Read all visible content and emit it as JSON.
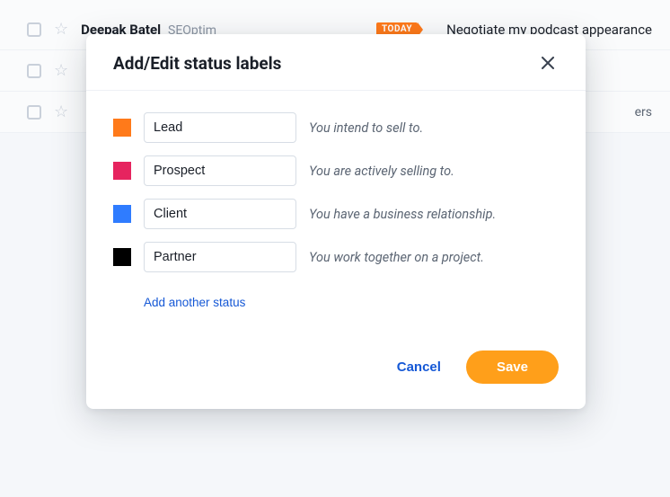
{
  "background": {
    "rows": [
      {
        "name": "Deepak Batel",
        "sub": "SEOptim",
        "tag": "TODAY",
        "subject": "Negotiate my podcast appearance"
      },
      {
        "right_fragment": "ers"
      }
    ]
  },
  "modal": {
    "title": "Add/Edit status labels",
    "statuses": [
      {
        "color": "#ff7a1a",
        "label": "Lead",
        "description": "You intend to sell to."
      },
      {
        "color": "#e6245f",
        "label": "Prospect",
        "description": "You are actively selling to."
      },
      {
        "color": "#2f7cff",
        "label": "Client",
        "description": "You have a business relationship."
      },
      {
        "color": "#000000",
        "label": "Partner",
        "description": "You work together on a project."
      }
    ],
    "add_link": "Add another status",
    "buttons": {
      "cancel": "Cancel",
      "save": "Save"
    }
  }
}
